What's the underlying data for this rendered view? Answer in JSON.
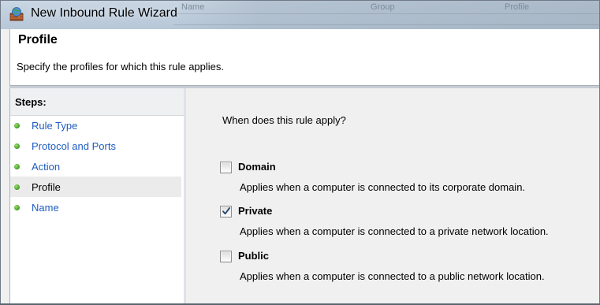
{
  "window": {
    "title": "New Inbound Rule Wizard",
    "icon": "firewall-rule-icon"
  },
  "background_window": {
    "columns": [
      "Name",
      "Group",
      "Profile"
    ]
  },
  "header": {
    "title": "Profile",
    "subtitle": "Specify the profiles for which this rule applies."
  },
  "steps": {
    "title": "Steps:",
    "items": [
      {
        "label": "Rule Type",
        "state": "completed"
      },
      {
        "label": "Protocol and Ports",
        "state": "completed"
      },
      {
        "label": "Action",
        "state": "completed"
      },
      {
        "label": "Profile",
        "state": "current"
      },
      {
        "label": "Name",
        "state": "pending"
      }
    ]
  },
  "main": {
    "question": "When does this rule apply?",
    "options": [
      {
        "label": "Domain",
        "checked": false,
        "description": "Applies when a computer is connected to its corporate domain."
      },
      {
        "label": "Private",
        "checked": true,
        "description": "Applies when a computer is connected to a private network location."
      },
      {
        "label": "Public",
        "checked": false,
        "description": "Applies when a computer is connected to a public network location."
      }
    ]
  },
  "colors": {
    "link": "#1f5cbf",
    "step_dot": "#4caf2a",
    "titlebar": "#c3d1df"
  }
}
